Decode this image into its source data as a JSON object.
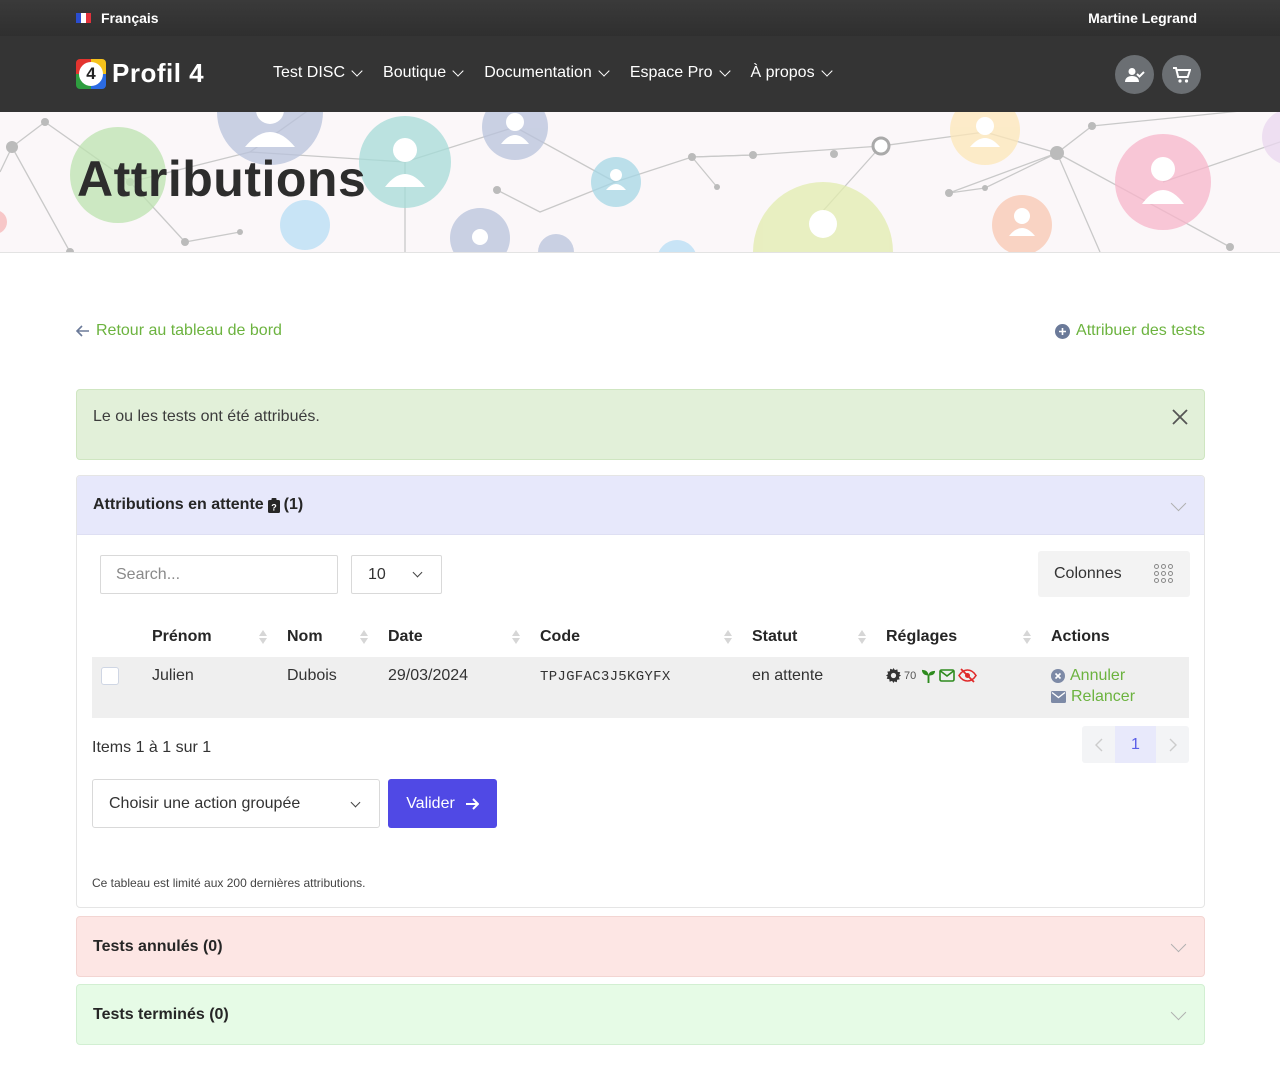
{
  "topbar": {
    "language": "Français",
    "user_name": "Martine Legrand"
  },
  "brand": {
    "logo_number": "4",
    "name": "Profil 4"
  },
  "nav": {
    "items": [
      {
        "label": "Test DISC"
      },
      {
        "label": "Boutique"
      },
      {
        "label": "Documentation"
      },
      {
        "label": "Espace Pro"
      },
      {
        "label": "À propos"
      }
    ],
    "icons": [
      "user-check-icon",
      "cart-icon"
    ]
  },
  "page": {
    "title": "Attributions"
  },
  "links": {
    "back": "Retour au tableau de bord",
    "assign": "Attribuer des tests"
  },
  "alert": {
    "message": "Le ou les tests ont été attribués."
  },
  "pending": {
    "title": "Attributions en attente",
    "count": "(1)",
    "search_placeholder": "Search...",
    "per_page": "10",
    "columns_button": "Colonnes",
    "headers": [
      "Prénom",
      "Nom",
      "Date",
      "Code",
      "Statut",
      "Réglages",
      "Actions"
    ],
    "rows": [
      {
        "first_name": "Julien",
        "last_name": "Dubois",
        "date": "29/03/2024",
        "code": "TPJGFAC3J5KGYFX",
        "status": "en attente",
        "settings_value": "70",
        "action_cancel": "Annuler",
        "action_remind": "Relancer"
      }
    ],
    "items_info": "Items 1 à 1 sur 1",
    "current_page": "1",
    "bulk_action": "Choisir une action groupée",
    "validate_label": "Valider",
    "footnote": "Ce tableau est limité aux 200 dernières attributions."
  },
  "cancelled": {
    "title": "Tests annulés (0)"
  },
  "finished": {
    "title": "Tests terminés (0)"
  },
  "colors": {
    "accent_green": "#6cb33f",
    "primary": "#5049e5",
    "dark_nav": "#343434"
  }
}
